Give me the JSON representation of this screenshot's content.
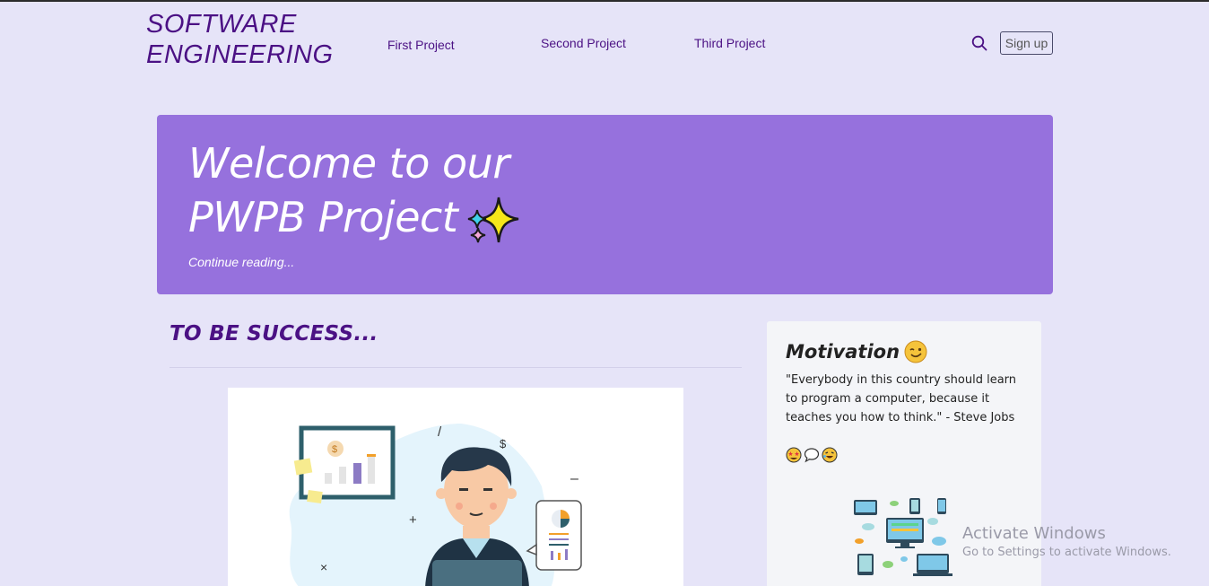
{
  "header": {
    "brand_line1": "SOFTWARE",
    "brand_line2": "ENGINEERING",
    "nav": [
      "First Project",
      "Second Project",
      "Third Project"
    ],
    "signup_label": "Sign up"
  },
  "hero": {
    "title_line1": "Welcome to our",
    "title_line2": "PWPB Project",
    "link": "Continue reading..."
  },
  "main": {
    "section_title": "TO BE SUCCESS..."
  },
  "sidebar": {
    "title": "Motivation",
    "quote": "\"Everybody in this country should learn to program a computer, because it teaches you how to think.\" - Steve Jobs"
  },
  "watermark": {
    "line1": "Activate Windows",
    "line2": "Go to Settings to activate Windows."
  },
  "colors": {
    "background": "#e6e4f8",
    "brand": "#4b1184",
    "hero": "#9671dd",
    "sidebar": "#f4f5f8"
  }
}
